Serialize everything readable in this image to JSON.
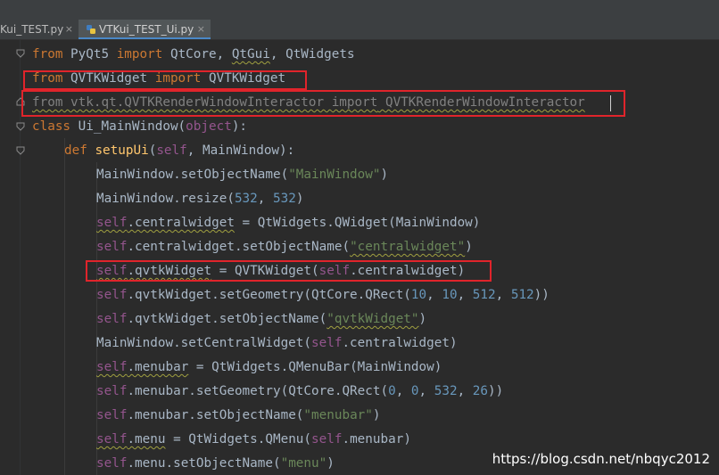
{
  "tabs": [
    {
      "label": "Kui_TEST.py",
      "close": "×"
    },
    {
      "label": "VTKui_TEST_Ui.py",
      "close": "×"
    }
  ],
  "code": {
    "l1": {
      "a": "from",
      "b": " PyQt5 ",
      "c": "import",
      "d": " QtCore, ",
      "e": "QtGui",
      "f": ", QtWidgets"
    },
    "l2": {
      "a": "from",
      "b": " QVTKWidget ",
      "c": "import",
      "d": " QVTKWidget"
    },
    "l3": {
      "a": "from",
      "b": " vtk.qt.QVTKRenderWindowInteractor ",
      "c": "import",
      "d": " QVTKRenderWindowInteractor"
    },
    "l4": {
      "a": "class",
      "b": " Ui_MainWindow(",
      "c": "object",
      "d": "):"
    },
    "l5": {
      "a": "def",
      "b": " ",
      "c": "setupUi",
      "d": "(",
      "e": "self",
      "f": ", MainWindow):"
    },
    "l6": {
      "a": "MainWindow.setObjectName(",
      "b": "\"MainWindow\"",
      "c": ")"
    },
    "l7": {
      "a": "MainWindow.resize(",
      "b": "532",
      "c": ", ",
      "d": "532",
      "e": ")"
    },
    "l8": {
      "a": "self",
      "b": ".centralwidget",
      "c": " = QtWidgets.QWidget(MainWindow)"
    },
    "l9": {
      "a": "self",
      "b": ".centralwidget.setObjectName(",
      "c": "\"centralwidget\"",
      "d": ")"
    },
    "l10": {
      "a": "self",
      "b": ".qvtkWidget",
      "c": " = QVTKWidget(",
      "d": "self",
      "e": ".centralwidget)"
    },
    "l11": {
      "a": "self",
      "b": ".qvtkWidget.setGeometry(QtCore.QRect(",
      "c": "10",
      "d": ", ",
      "e": "10",
      "f": ", ",
      "g": "512",
      "h": ", ",
      "i": "512",
      "j": "))"
    },
    "l12": {
      "a": "self",
      "b": ".qvtkWidget.setObjectName(",
      "c": "\"qvtkWidget\"",
      "d": ")"
    },
    "l13": {
      "a": "MainWindow.setCentralWidget(",
      "b": "self",
      "c": ".centralwidget)"
    },
    "l14": {
      "a": "self",
      "b": ".menubar",
      "c": " = QtWidgets.QMenuBar(MainWindow)"
    },
    "l15": {
      "a": "self",
      "b": ".menubar.setGeometry(QtCore.QRect(",
      "c": "0",
      "d": ", ",
      "e": "0",
      "f": ", ",
      "g": "532",
      "h": ", ",
      "i": "26",
      "j": "))"
    },
    "l16": {
      "a": "self",
      "b": ".menubar.setObjectName(",
      "c": "\"menubar\"",
      "d": ")"
    },
    "l17": {
      "a": "self",
      "b": ".menu",
      "c": " = QtWidgets.QMenu(",
      "d": "self",
      "e": ".menubar)"
    },
    "l18": {
      "a": "self",
      "b": ".menu.setObjectName(",
      "c": "\"menu\"",
      "d": ")"
    }
  },
  "watermark": "https://blog.csdn.net/nbqyc2012",
  "colors": {
    "highlight": "#e0242b",
    "keyword": "#cc7832",
    "string": "#6a8759",
    "number": "#6897bb",
    "self": "#94558d",
    "function": "#ffc66d"
  }
}
